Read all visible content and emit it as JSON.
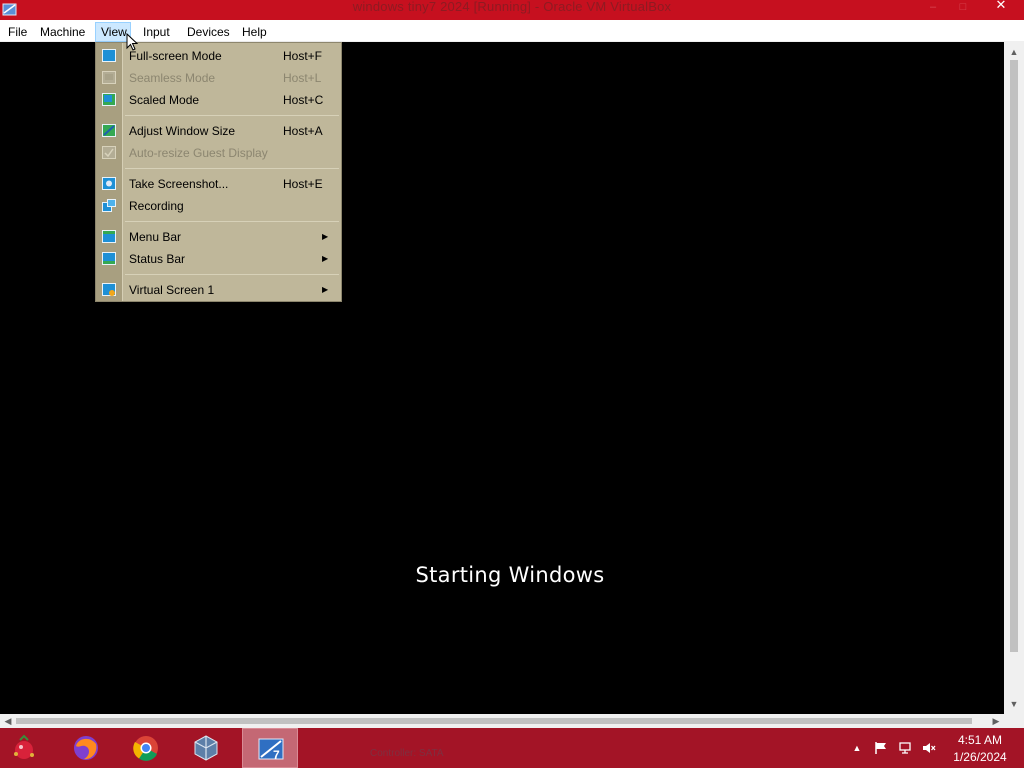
{
  "window": {
    "title": "windows tiny7 2024 [Running] - Oracle VM VirtualBox",
    "close_glyph": "✕"
  },
  "menubar": {
    "items": [
      {
        "label": "File"
      },
      {
        "label": "Machine"
      },
      {
        "label": "View"
      },
      {
        "label": "Input"
      },
      {
        "label": "Devices"
      },
      {
        "label": "Help"
      }
    ]
  },
  "view_menu": {
    "items": [
      {
        "label": "Full-screen Mode",
        "shortcut": "Host+F",
        "icon": "fullscreen-icon",
        "enabled": true
      },
      {
        "label": "Seamless Mode",
        "shortcut": "Host+L",
        "icon": "seamless-icon",
        "enabled": false
      },
      {
        "label": "Scaled Mode",
        "shortcut": "Host+C",
        "icon": "scaled-icon",
        "enabled": true
      },
      {
        "label": "Adjust Window Size",
        "shortcut": "Host+A",
        "icon": "adjust-window-icon",
        "enabled": true
      },
      {
        "label": "Auto-resize Guest Display",
        "shortcut": "",
        "icon": "auto-resize-icon",
        "enabled": false
      },
      {
        "label": "Take Screenshot...",
        "shortcut": "Host+E",
        "icon": "screenshot-icon",
        "enabled": true
      },
      {
        "label": "Recording",
        "shortcut": "",
        "icon": "recording-icon",
        "enabled": true
      },
      {
        "label": "Menu Bar",
        "shortcut": "",
        "icon": "menu-bar-icon",
        "enabled": true,
        "submenu": true
      },
      {
        "label": "Status Bar",
        "shortcut": "",
        "icon": "status-bar-icon",
        "enabled": true,
        "submenu": true
      },
      {
        "label": "Virtual Screen 1",
        "shortcut": "",
        "icon": "virtual-screen-icon",
        "enabled": true,
        "submenu": true
      }
    ],
    "submenu_glyph": "▶"
  },
  "guest": {
    "message": "Starting Windows"
  },
  "scrollbars": {
    "up": "▲",
    "down": "▼",
    "left": "◀",
    "right": "▶"
  },
  "taskbar": {
    "tray_text": "Controller: SATA",
    "time": "4:51 AM",
    "date": "1/26/2024",
    "show_hidden_glyph": "▲"
  },
  "colors": {
    "titlebar": "#c6101f",
    "taskbar": "#a31426",
    "menu_bg": "#bfb79a",
    "menu_hover": "#cce8ff"
  }
}
